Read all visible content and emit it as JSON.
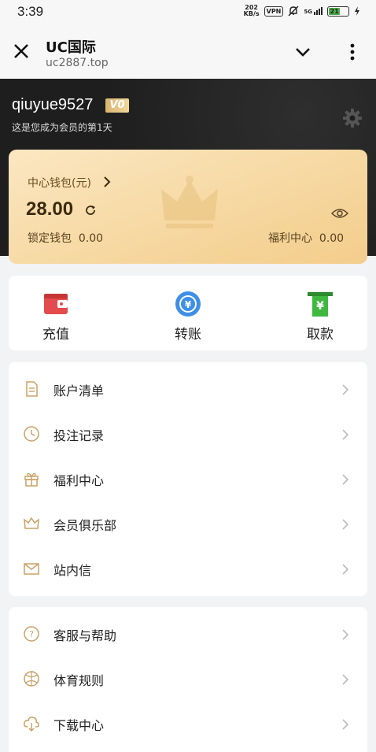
{
  "status_bar": {
    "time": "3:39",
    "net_speed_top": "202",
    "net_speed_bottom": "KB/s",
    "vpn": "VPN",
    "signal": "5G",
    "battery": "21"
  },
  "browser": {
    "title": "UC国际",
    "url": "uc2887.top"
  },
  "profile": {
    "username": "qiuyue9527",
    "vip_level": "V0",
    "member_days": "这是您成为会员的第1天"
  },
  "wallet": {
    "title": "中心钱包(元)",
    "amount": "28.00",
    "locked_label": "锁定钱包",
    "locked_value": "0.00",
    "welfare_label": "福利中心",
    "welfare_value": "0.00"
  },
  "actions": [
    {
      "label": "充值",
      "icon": "wallet-icon"
    },
    {
      "label": "转账",
      "icon": "transfer-icon"
    },
    {
      "label": "取款",
      "icon": "withdraw-icon"
    }
  ],
  "menu_group_1": [
    {
      "label": "账户清单",
      "icon": "document-icon"
    },
    {
      "label": "投注记录",
      "icon": "clock-icon"
    },
    {
      "label": "福利中心",
      "icon": "gift-icon"
    },
    {
      "label": "会员俱乐部",
      "icon": "crown-icon"
    },
    {
      "label": "站内信",
      "icon": "mail-icon"
    }
  ],
  "menu_group_2": [
    {
      "label": "客服与帮助",
      "icon": "help-icon"
    },
    {
      "label": "体育规则",
      "icon": "ball-icon"
    },
    {
      "label": "下载中心",
      "icon": "cloud-download-icon"
    }
  ],
  "colors": {
    "accent_gold": "#c8a265",
    "card_gold": "#f6d79f",
    "hero_dark": "#1e1e1e"
  }
}
